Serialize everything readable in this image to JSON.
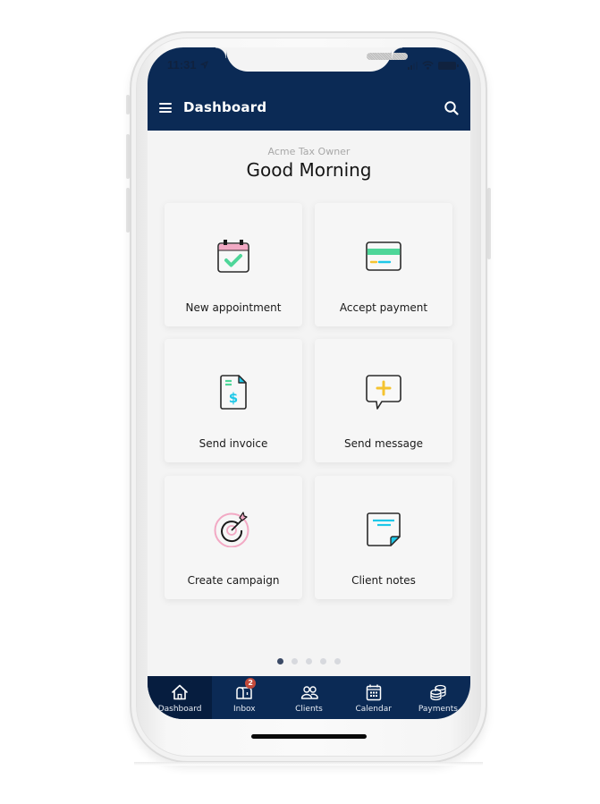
{
  "status_bar": {
    "time": "11:31",
    "location_icon": "location-arrow-icon",
    "signal_icon": "cellular-signal-icon",
    "wifi_icon": "wifi-icon",
    "battery_icon": "battery-icon"
  },
  "app_bar": {
    "menu_icon": "hamburger-menu-icon",
    "title": "Dashboard",
    "search_icon": "search-icon",
    "background_color": "#0b2a55"
  },
  "header": {
    "business_name": "Acme Tax Owner",
    "greeting": "Good Morning"
  },
  "actions": [
    {
      "label": "New appointment",
      "icon": "calendar-check-icon"
    },
    {
      "label": "Accept payment",
      "icon": "credit-card-icon"
    },
    {
      "label": "Send invoice",
      "icon": "invoice-dollar-icon"
    },
    {
      "label": "Send message",
      "icon": "message-plus-icon"
    },
    {
      "label": "Create campaign",
      "icon": "target-dart-icon"
    },
    {
      "label": "Client notes",
      "icon": "note-icon"
    }
  ],
  "pager": {
    "total": 5,
    "active_index": 0
  },
  "tab_bar": {
    "tabs": [
      {
        "label": "Dashboard",
        "icon": "home-icon",
        "active": true
      },
      {
        "label": "Inbox",
        "icon": "mailbox-icon",
        "badge": "2"
      },
      {
        "label": "Clients",
        "icon": "users-icon"
      },
      {
        "label": "Calendar",
        "icon": "calendar-icon"
      },
      {
        "label": "Payments",
        "icon": "coins-icon"
      }
    ]
  },
  "colors": {
    "primary_navy": "#0b2a55",
    "accent_green": "#4fd699",
    "accent_pink": "#f2a9c4",
    "accent_cyan": "#1ec8e8",
    "accent_yellow": "#f5c330",
    "badge_red": "#c24a3b"
  }
}
